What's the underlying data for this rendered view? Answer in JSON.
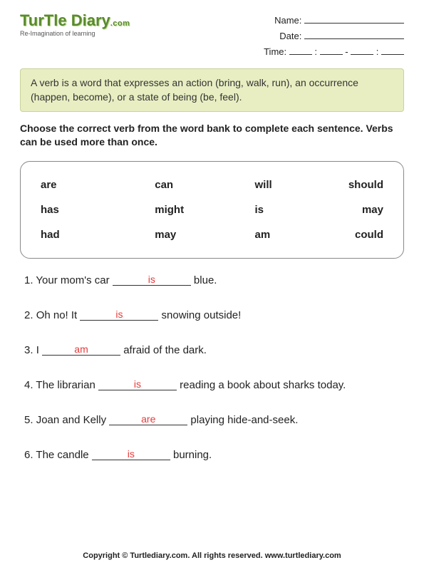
{
  "logo": {
    "main": "TurTle Diary",
    "dotcom": ".com",
    "tagline": "Re-Imagination of learning"
  },
  "meta": {
    "name_label": "Name:",
    "date_label": "Date:",
    "time_label": "Time:"
  },
  "info_box": "A verb is a word that expresses an action (bring, walk, run), an occurrence (happen, become), or a state of being (be, feel).",
  "instructions": "Choose the correct verb from the word bank to complete each sentence. Verbs can be used more than once.",
  "word_bank": [
    [
      "are",
      "can",
      "will",
      "should"
    ],
    [
      "has",
      "might",
      "is",
      "may"
    ],
    [
      "had",
      "may",
      "am",
      "could"
    ]
  ],
  "questions": [
    {
      "num": "1.",
      "pre": "Your mom's car ",
      "answer": "is",
      "post": " blue."
    },
    {
      "num": "2.",
      "pre": "Oh no! It ",
      "answer": "is",
      "post": " snowing outside!"
    },
    {
      "num": "3.",
      "pre": "I ",
      "answer": "am",
      "post": " afraid of the dark."
    },
    {
      "num": "4.",
      "pre": "The librarian ",
      "answer": "is",
      "post": " reading a book about sharks today."
    },
    {
      "num": "5.",
      "pre": "Joan and Kelly ",
      "answer": "are",
      "post": " playing hide-and-seek."
    },
    {
      "num": "6.",
      "pre": "The candle ",
      "answer": "is",
      "post": " burning."
    }
  ],
  "footer": "Copyright © Turtlediary.com. All rights reserved. www.turtlediary.com"
}
